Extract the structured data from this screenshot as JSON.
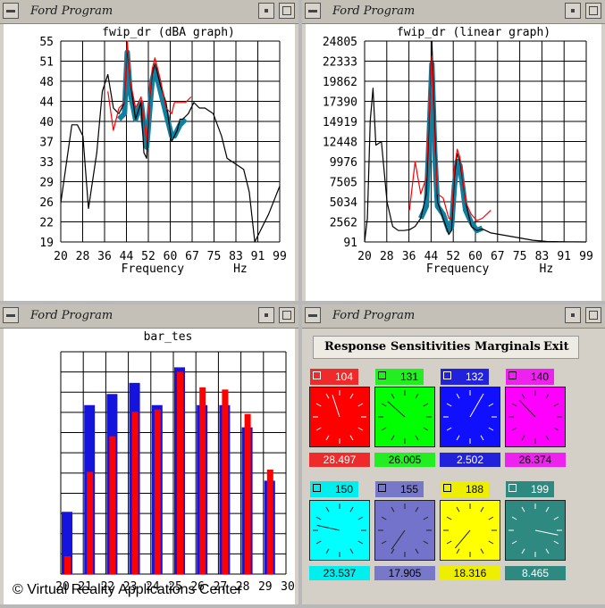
{
  "window_title": "Ford Program",
  "copyright": "© Virtual Reality Applications Center",
  "graphs": {
    "dba": {
      "title": "fwip_dr (dBA graph)",
      "y_ticks": [
        "55",
        "51",
        "48",
        "44",
        "40",
        "37",
        "33",
        "29",
        "26",
        "22",
        "19"
      ],
      "x_ticks": [
        "20",
        "28",
        "36",
        "44",
        "52",
        "60",
        "67",
        "75",
        "83",
        "91",
        "99"
      ],
      "x_label": "Frequency",
      "x_unit": "Hz"
    },
    "linear": {
      "title": "fwip_dr (linear graph)",
      "y_ticks": [
        "24805",
        "22333",
        "19862",
        "17390",
        "14919",
        "12448",
        "9976",
        "7505",
        "5034",
        "2562",
        "91"
      ],
      "x_ticks": [
        "20",
        "28",
        "36",
        "44",
        "52",
        "60",
        "67",
        "75",
        "83",
        "91",
        "99"
      ],
      "x_label": "Frequency",
      "x_unit": "Hz"
    },
    "bar": {
      "title": "bar_tes",
      "x_ticks": [
        "20",
        "21",
        "22",
        "23",
        "24",
        "25",
        "26",
        "27",
        "28",
        "29",
        "30"
      ]
    }
  },
  "menu": {
    "response": "Response",
    "sensitivities": "Sensitivities",
    "marginals": "Marginals",
    "exit": "Exit"
  },
  "controls": [
    {
      "id": "104",
      "value": "28.497",
      "color": "#ff0000",
      "head": "#ee2a2a",
      "text": "#ffffff"
    },
    {
      "id": "131",
      "value": "26.005",
      "color": "#00ff00",
      "head": "#22ee22",
      "text": "#000000"
    },
    {
      "id": "132",
      "value": "2.502",
      "color": "#1010ff",
      "head": "#2222dd",
      "text": "#ffffff"
    },
    {
      "id": "140",
      "value": "26.374",
      "color": "#ff00ff",
      "head": "#ee22ee",
      "text": "#000000"
    },
    {
      "id": "150",
      "value": "23.537",
      "color": "#00ffff",
      "head": "#00eeee",
      "text": "#000000"
    },
    {
      "id": "155",
      "value": "17.905",
      "color": "#7373cc",
      "head": "#7878c8",
      "text": "#000000"
    },
    {
      "id": "188",
      "value": "18.316",
      "color": "#ffff00",
      "head": "#eeee00",
      "text": "#000000"
    },
    {
      "id": "199",
      "value": "8.465",
      "color": "#2e8a80",
      "head": "#2e8a80",
      "text": "#ffffff"
    }
  ],
  "chart_data": [
    {
      "type": "line",
      "title": "fwip_dr (dBA graph)",
      "xlabel": "Frequency",
      "xunit": "Hz",
      "xlim": [
        20,
        99
      ],
      "ylim": [
        19,
        55
      ],
      "series": [
        {
          "color": "#000000",
          "x": [
            20,
            22,
            24,
            26,
            28,
            30,
            33,
            35,
            37,
            39,
            41,
            43,
            44,
            45,
            47,
            49,
            50,
            51,
            52,
            53,
            54,
            56,
            58,
            60,
            61,
            62,
            63,
            64,
            66,
            68,
            70,
            72,
            75,
            78,
            80,
            83,
            86,
            88,
            90,
            92,
            95,
            99
          ],
          "y": [
            26,
            33,
            40,
            40,
            38,
            25,
            35,
            46,
            49,
            43,
            42,
            44,
            54,
            48,
            41,
            44,
            35,
            34,
            44,
            49,
            51,
            47,
            44,
            37,
            38,
            39,
            41,
            41,
            42,
            44,
            43,
            43,
            42,
            38,
            34,
            33,
            32,
            28,
            19,
            21,
            24,
            29
          ]
        },
        {
          "color": "#ff0000",
          "x": [
            37,
            39,
            41,
            43,
            44,
            45,
            47,
            49,
            51,
            52,
            53,
            54,
            56,
            58,
            60,
            61,
            63,
            65,
            67
          ],
          "y": [
            46,
            39,
            43,
            44,
            55,
            48,
            43,
            45,
            37,
            44,
            50,
            52,
            48,
            43,
            42,
            44,
            44,
            44,
            45
          ]
        },
        {
          "color": "#1080a0",
          "x": [
            41,
            43,
            44,
            45,
            47,
            49,
            51,
            52,
            53,
            54,
            56,
            58,
            60,
            61,
            63,
            65
          ],
          "y": [
            41,
            42,
            53,
            46,
            41,
            44,
            36,
            42,
            48,
            50,
            46,
            42,
            38,
            38,
            40,
            41
          ]
        }
      ]
    },
    {
      "type": "line",
      "title": "fwip_dr (linear graph)",
      "xlabel": "Frequency",
      "xunit": "Hz",
      "xlim": [
        20,
        99
      ],
      "ylim": [
        91,
        24805
      ],
      "series": [
        {
          "color": "#000000",
          "x": [
            20,
            21,
            22,
            23,
            24,
            26,
            28,
            30,
            32,
            34,
            36,
            38,
            40,
            42,
            43,
            44,
            45,
            46,
            48,
            50,
            51,
            52,
            53,
            54,
            56,
            58,
            60,
            62,
            65,
            70,
            75,
            80,
            85,
            90,
            95,
            99
          ],
          "y": [
            91,
            3000,
            15000,
            19000,
            12000,
            12448,
            5000,
            2000,
            1500,
            1500,
            1600,
            2000,
            3000,
            6000,
            15000,
            24805,
            14000,
            5000,
            3000,
            1000,
            1500,
            8000,
            11000,
            9976,
            5000,
            2000,
            1500,
            1700,
            1200,
            900,
            600,
            300,
            150,
            120,
            100,
            91
          ]
        },
        {
          "color": "#ff0000",
          "x": [
            36,
            38,
            40,
            42,
            43,
            44,
            45,
            46,
            48,
            50,
            51,
            52,
            53,
            54,
            56,
            58,
            60,
            62,
            65
          ],
          "y": [
            4000,
            9976,
            6000,
            8000,
            16000,
            23000,
            12000,
            6000,
            5500,
            3000,
            3000,
            9000,
            11500,
            10500,
            5000,
            3500,
            2700,
            3000,
            4000
          ]
        },
        {
          "color": "#1080a0",
          "x": [
            40,
            42,
            43,
            44,
            45,
            46,
            48,
            50,
            51,
            52,
            53,
            54,
            56,
            58,
            60,
            62
          ],
          "y": [
            3000,
            4500,
            13000,
            22000,
            11000,
            4500,
            3500,
            1500,
            2000,
            7000,
            10000,
            9500,
            4000,
            2500,
            1500,
            1800
          ]
        }
      ]
    },
    {
      "type": "bar",
      "title": "bar_tes",
      "categories": [
        "20",
        "21",
        "22",
        "23",
        "24",
        "25",
        "26",
        "27",
        "28",
        "29"
      ],
      "ylim": [
        0,
        100
      ],
      "series": [
        {
          "color": "#1414dd",
          "values": [
            28,
            76,
            81,
            86,
            76,
            93,
            76,
            76,
            66,
            42
          ]
        },
        {
          "color": "#ff0000",
          "values": [
            8,
            46,
            62,
            73,
            74,
            91,
            84,
            83,
            72,
            47
          ]
        }
      ]
    }
  ]
}
